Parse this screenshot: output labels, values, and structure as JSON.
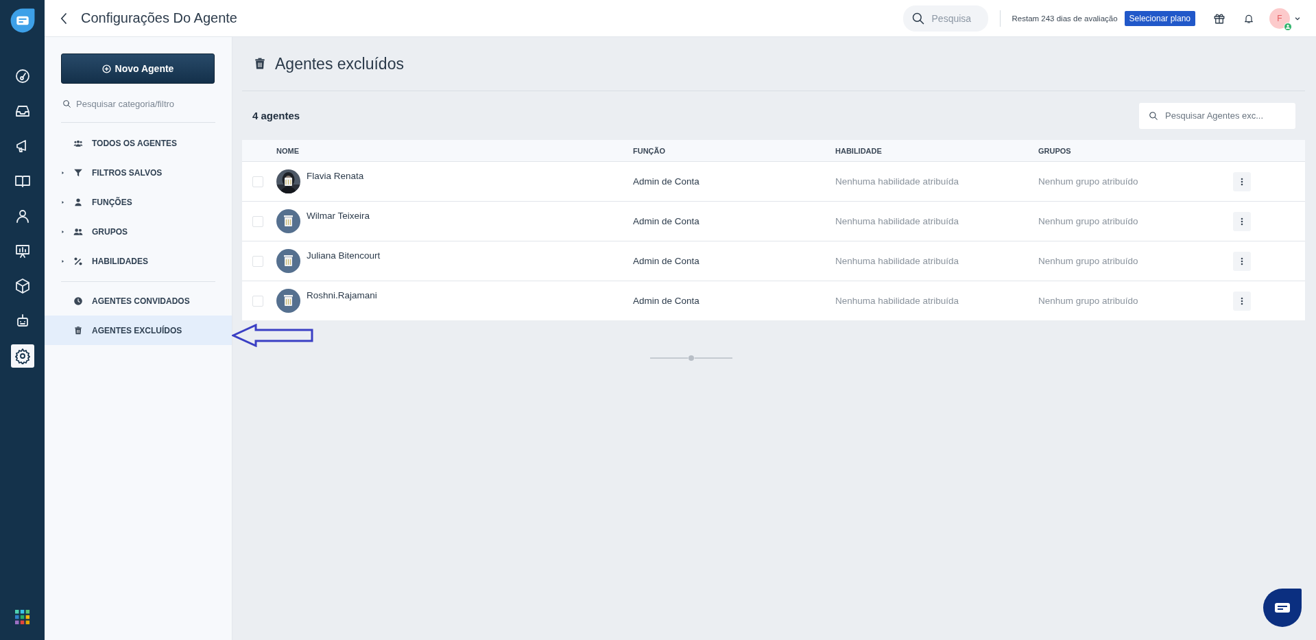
{
  "rail": {
    "items": [
      {
        "kind": "dashboard",
        "selected": false
      },
      {
        "kind": "inbox",
        "selected": false
      },
      {
        "kind": "campaigns",
        "selected": false
      },
      {
        "kind": "knowledge",
        "selected": false
      },
      {
        "kind": "contacts",
        "selected": false
      },
      {
        "kind": "reports",
        "selected": false
      },
      {
        "kind": "products",
        "selected": false
      },
      {
        "kind": "bot",
        "selected": false
      },
      {
        "kind": "settings",
        "selected": true
      }
    ]
  },
  "topbar": {
    "back": true,
    "title": "Configurações Do Agente",
    "search": {
      "placeholder": "Pesquisa"
    },
    "trial": "Restam 243 dias de avaliação",
    "plan_button": "Selecionar plano",
    "avatar": {
      "initial": "F",
      "online": true
    }
  },
  "sidebar": {
    "new_button": "Novo Agente",
    "search": {
      "placeholder": "Pesquisar categoria/filtro"
    },
    "groups": [
      [
        {
          "label": "TODOS OS AGENTES",
          "kind": "people",
          "expandable": false,
          "selected": false
        },
        {
          "label": "FILTROS SALVOS",
          "kind": "filter",
          "expandable": true,
          "selected": false
        },
        {
          "label": "FUNÇÕES",
          "kind": "person",
          "expandable": true,
          "selected": false
        },
        {
          "label": "GRUPOS",
          "kind": "group",
          "expandable": true,
          "selected": false
        },
        {
          "label": "HABILIDADES",
          "kind": "skills",
          "expandable": true,
          "selected": false
        }
      ],
      [
        {
          "label": "AGENTES CONVIDADOS",
          "kind": "clock",
          "expandable": false,
          "selected": false
        },
        {
          "label": "AGENTES EXCLUÍDOS",
          "kind": "trash",
          "expandable": false,
          "selected": true
        }
      ]
    ]
  },
  "main": {
    "title": "Agentes excluídos",
    "count": "4 agentes",
    "search": {
      "placeholder": "Pesquisar Agentes exc..."
    },
    "table": {
      "columns": [
        "NOME",
        "FUNÇÃO",
        "HABILIDADE",
        "GRUPOS"
      ],
      "rows": [
        {
          "checked": false,
          "name": "Flavia Renata",
          "role": "Admin de Conta",
          "skills": "Nenhuma habilidade atribuída",
          "groups": "Nenhum grupo atribuído"
        },
        {
          "checked": false,
          "kind": "default",
          "name": "Wilmar Teixeira",
          "role": "Admin de Conta",
          "skills": "Nenhuma habilidade atribuída",
          "groups": "Nenhum grupo atribuído"
        },
        {
          "checked": false,
          "kind": "default",
          "name": "Juliana Bitencourt",
          "role": "Admin de Conta",
          "skills": "Nenhuma habilidade atribuída",
          "groups": "Nenhum grupo atribuído"
        },
        {
          "checked": false,
          "kind": "default",
          "name": "Roshni.Rajamani",
          "role": "Admin de Conta",
          "skills": "Nenhuma habilidade atribuída",
          "groups": "Nenhum grupo atribuído"
        }
      ]
    }
  }
}
